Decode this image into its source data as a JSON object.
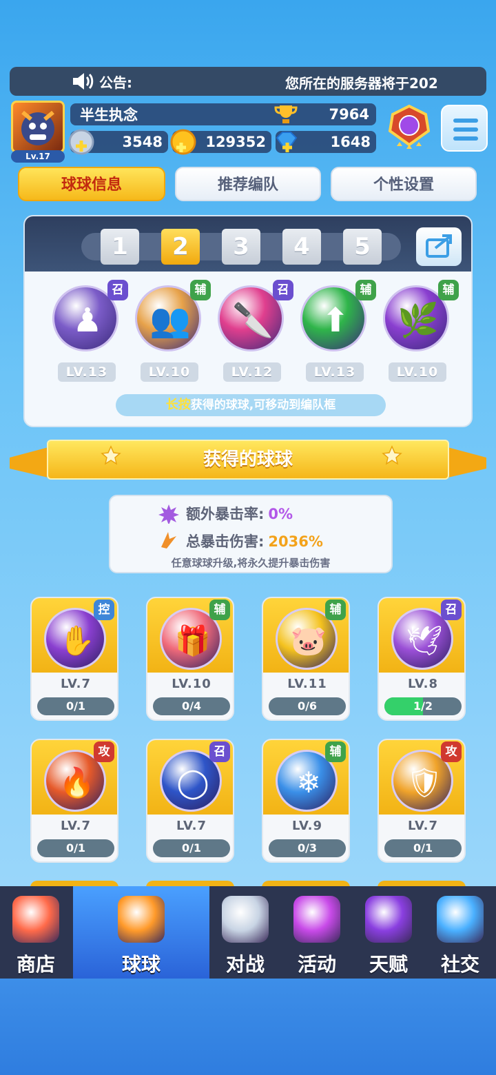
{
  "announcement": {
    "label": "公告:",
    "message": "您所在的服务器将于202"
  },
  "player": {
    "level": "Lv.17",
    "name": "半生执念",
    "trophies": "7964"
  },
  "resources": {
    "energy": "3548",
    "coins": "129352",
    "gems": "1648"
  },
  "tabs": [
    {
      "label": "球球信息",
      "active": true
    },
    {
      "label": "推荐编队",
      "active": false
    },
    {
      "label": "个性设置",
      "active": false
    }
  ],
  "team": {
    "slots": [
      "1",
      "2",
      "3",
      "4",
      "5"
    ],
    "active_slot": "2",
    "balls": [
      {
        "badge": "召",
        "level": "LV.13",
        "color": "#7b5cc8",
        "glyph": "♟"
      },
      {
        "badge": "辅",
        "level": "LV.10",
        "color": "#e7a24a",
        "glyph": "👥"
      },
      {
        "badge": "召",
        "level": "LV.12",
        "color": "#e03f8e",
        "glyph": "🔪"
      },
      {
        "badge": "辅",
        "level": "LV.13",
        "color": "#2fb54a",
        "glyph": "⬆"
      },
      {
        "badge": "辅",
        "level": "LV.10",
        "color": "#8a3fd0",
        "glyph": "🌿"
      }
    ],
    "hint_highlight": "长按",
    "hint_text": "获得的球球,可移动到编队框"
  },
  "section_title": "获得的球球",
  "crit": {
    "extra_rate_label": "额外暴击率:",
    "extra_rate_value": "0%",
    "total_damage_label": "总暴击伤害:",
    "total_damage_value": "2036%",
    "note": "任意球球升级,将永久提升暴击伤害"
  },
  "balls": [
    {
      "badge": "控",
      "level": "LV.7",
      "progress": "0/1",
      "fill": 0.0,
      "color": "#8a3fd0",
      "glyph": "✋"
    },
    {
      "badge": "辅",
      "level": "LV.10",
      "progress": "0/4",
      "fill": 0.0,
      "color": "#f06a7a",
      "glyph": "🎁"
    },
    {
      "badge": "辅",
      "level": "LV.11",
      "progress": "0/6",
      "fill": 0.0,
      "color": "#f4c21e",
      "glyph": "🐷"
    },
    {
      "badge": "召",
      "level": "LV.8",
      "progress": "1/2",
      "fill": 0.5,
      "color": "#9a4fd6",
      "glyph": "🕊"
    },
    {
      "badge": "攻",
      "level": "LV.7",
      "progress": "0/1",
      "fill": 0.0,
      "color": "#e65a2a",
      "glyph": "🔥"
    },
    {
      "badge": "召",
      "level": "LV.7",
      "progress": "0/1",
      "fill": 0.0,
      "color": "#2e55c8",
      "glyph": "◯"
    },
    {
      "badge": "辅",
      "level": "LV.9",
      "progress": "0/3",
      "fill": 0.0,
      "color": "#3a8fe8",
      "glyph": "❄"
    },
    {
      "badge": "攻",
      "level": "LV.7",
      "progress": "0/1",
      "fill": 0.0,
      "color": "#f0a32a",
      "glyph": "🛡"
    }
  ],
  "nav": [
    {
      "label": "商店",
      "icon": "shop-icon"
    },
    {
      "label": "球球",
      "icon": "ball-icon",
      "active": true
    },
    {
      "label": "对战",
      "icon": "swords-icon"
    },
    {
      "label": "活动",
      "icon": "party-icon"
    },
    {
      "label": "天赋",
      "icon": "planet-icon"
    },
    {
      "label": "社交",
      "icon": "chat-icon"
    }
  ]
}
